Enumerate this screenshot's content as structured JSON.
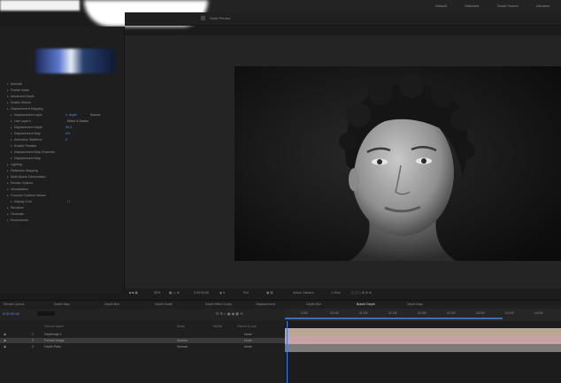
{
  "workspaces": [
    "Default",
    "Standard",
    "Small Screen",
    "Libraries"
  ],
  "comp_tab": "Depth Preview",
  "effects_tree": [
    {
      "label": "Animate",
      "indent": 1
    },
    {
      "label": "Fractal Noise",
      "indent": 1
    },
    {
      "label": "Advanced Depth",
      "indent": 1
    },
    {
      "label": "Enable Motion",
      "indent": 1
    },
    {
      "label": "Displacement Mapping",
      "indent": 1
    },
    {
      "label": "Displacement Layer",
      "indent": 2,
      "value": "1. depth",
      "value2": "Source"
    },
    {
      "label": "Use Layer's",
      "indent": 2,
      "value2": "Effect & Masks"
    },
    {
      "label": "Displacement Depth",
      "indent": 2,
      "value": "50.0"
    },
    {
      "label": "Displacement Map",
      "indent": 2,
      "value": "0%"
    },
    {
      "label": "Animation Stabilizer",
      "indent": 2,
      "value": "0"
    },
    {
      "label": "Enable Parallax",
      "indent": 2
    },
    {
      "label": "Displacement Map Channels",
      "indent": 2
    },
    {
      "label": "Displacement Map",
      "indent": 2
    },
    {
      "label": "Lighting",
      "indent": 1
    },
    {
      "label": "Reflection Mapping",
      "indent": 1
    },
    {
      "label": "Multi-Space Deformation",
      "indent": 1
    },
    {
      "label": "Render Options",
      "indent": 1
    },
    {
      "label": "Visualization",
      "indent": 1
    },
    {
      "label": "Connect Controls Values",
      "indent": 1
    },
    {
      "label": "Display Grid",
      "indent": 2,
      "value2": "☐"
    },
    {
      "label": "Renderer",
      "indent": 1
    },
    {
      "label": "Generate",
      "indent": 1
    },
    {
      "label": "Environment",
      "indent": 1
    }
  ],
  "comp_toolbar": [
    "50%",
    "0:00:00:00",
    "Full",
    "Active Camera",
    "1 View"
  ],
  "timeline_tabs": [
    "Render Queue",
    "Depth Map",
    "Depth Blur",
    "Depth Scale",
    "Depth Effect Comp",
    "Displacement",
    "Depth Blur",
    "Bokeh Depth",
    "Depth Map"
  ],
  "timecode": "0:00:00:00",
  "layer_headers": [
    "Source Name",
    "Mode",
    "TrkMat",
    "Parent & Link"
  ],
  "layers": [
    {
      "num": "1",
      "name": "Depthmap 1",
      "mode": "",
      "parent": "None"
    },
    {
      "num": "2",
      "name": "Portrait Image",
      "mode": "Normal",
      "parent": "None"
    },
    {
      "num": "3",
      "name": "Depth Pass",
      "mode": "Normal",
      "parent": "None"
    }
  ],
  "ruler_ticks": [
    "0:00f",
    "00:15f",
    "01:00f",
    "01:15f",
    "02:00f",
    "02:15f",
    "03:00f",
    "03:15f",
    "04:00f"
  ],
  "colors": {
    "accent": "#4e8df0",
    "bar_tan": "#b9a793",
    "bar_pink": "#c7a3a8",
    "bar_gray": "#7d7a77"
  }
}
